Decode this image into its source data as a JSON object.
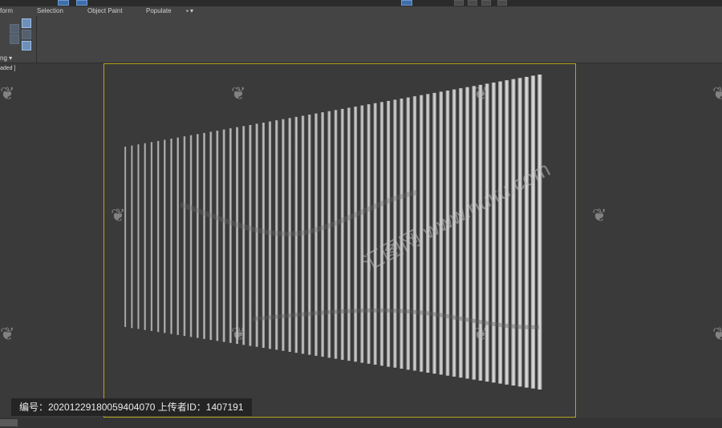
{
  "menu": {
    "form": "form",
    "selection": "Selection",
    "object_paint": "Object Paint",
    "populate": "Populate"
  },
  "ribbon": {
    "dropdown_label": "ng ▾"
  },
  "viewport": {
    "shading_label": "aded ]"
  },
  "watermark": {
    "text": "汇图网 www.huitu.com",
    "icon": "leaf-logo-icon"
  },
  "caption": {
    "text": "编号：20201229180059404070 上传者ID：1407191"
  },
  "colors": {
    "background": "#3a3a3a",
    "active_viewport_border": "#b7a51f",
    "fins": "#c8c8c8"
  }
}
